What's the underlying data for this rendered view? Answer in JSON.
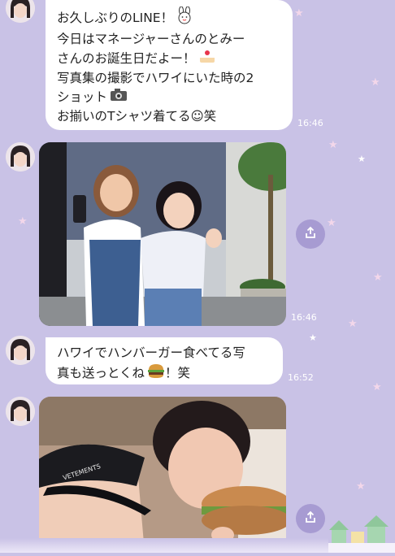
{
  "chat": {
    "messages": [
      {
        "type": "text",
        "lines": [
          "お久しぶりのLINE！",
          "今日はマネージャーさんのとみー",
          "さんのお誕生日だよー！",
          "写真集の撮影でハワイにいた時の2",
          "ショット",
          "お揃いのTシャツ着てる☺笑"
        ],
        "time": "16:46"
      },
      {
        "type": "photo",
        "time": "16:46"
      },
      {
        "type": "text",
        "lines": [
          "ハワイでハンバーガー食べてる写",
          "真も送っとくね",
          "！笑"
        ],
        "time": "16:52"
      },
      {
        "type": "photo",
        "cap_text": "VETEMENTS"
      }
    ]
  },
  "icons": [
    "rabbit-emoji-icon",
    "cake-emoji-icon",
    "camera-emoji-icon",
    "hamburger-emoji-icon",
    "share-icon"
  ],
  "colors": {
    "background": "#c9c2e6",
    "bubble": "#ffffff",
    "share_button": "#a79bd2"
  }
}
